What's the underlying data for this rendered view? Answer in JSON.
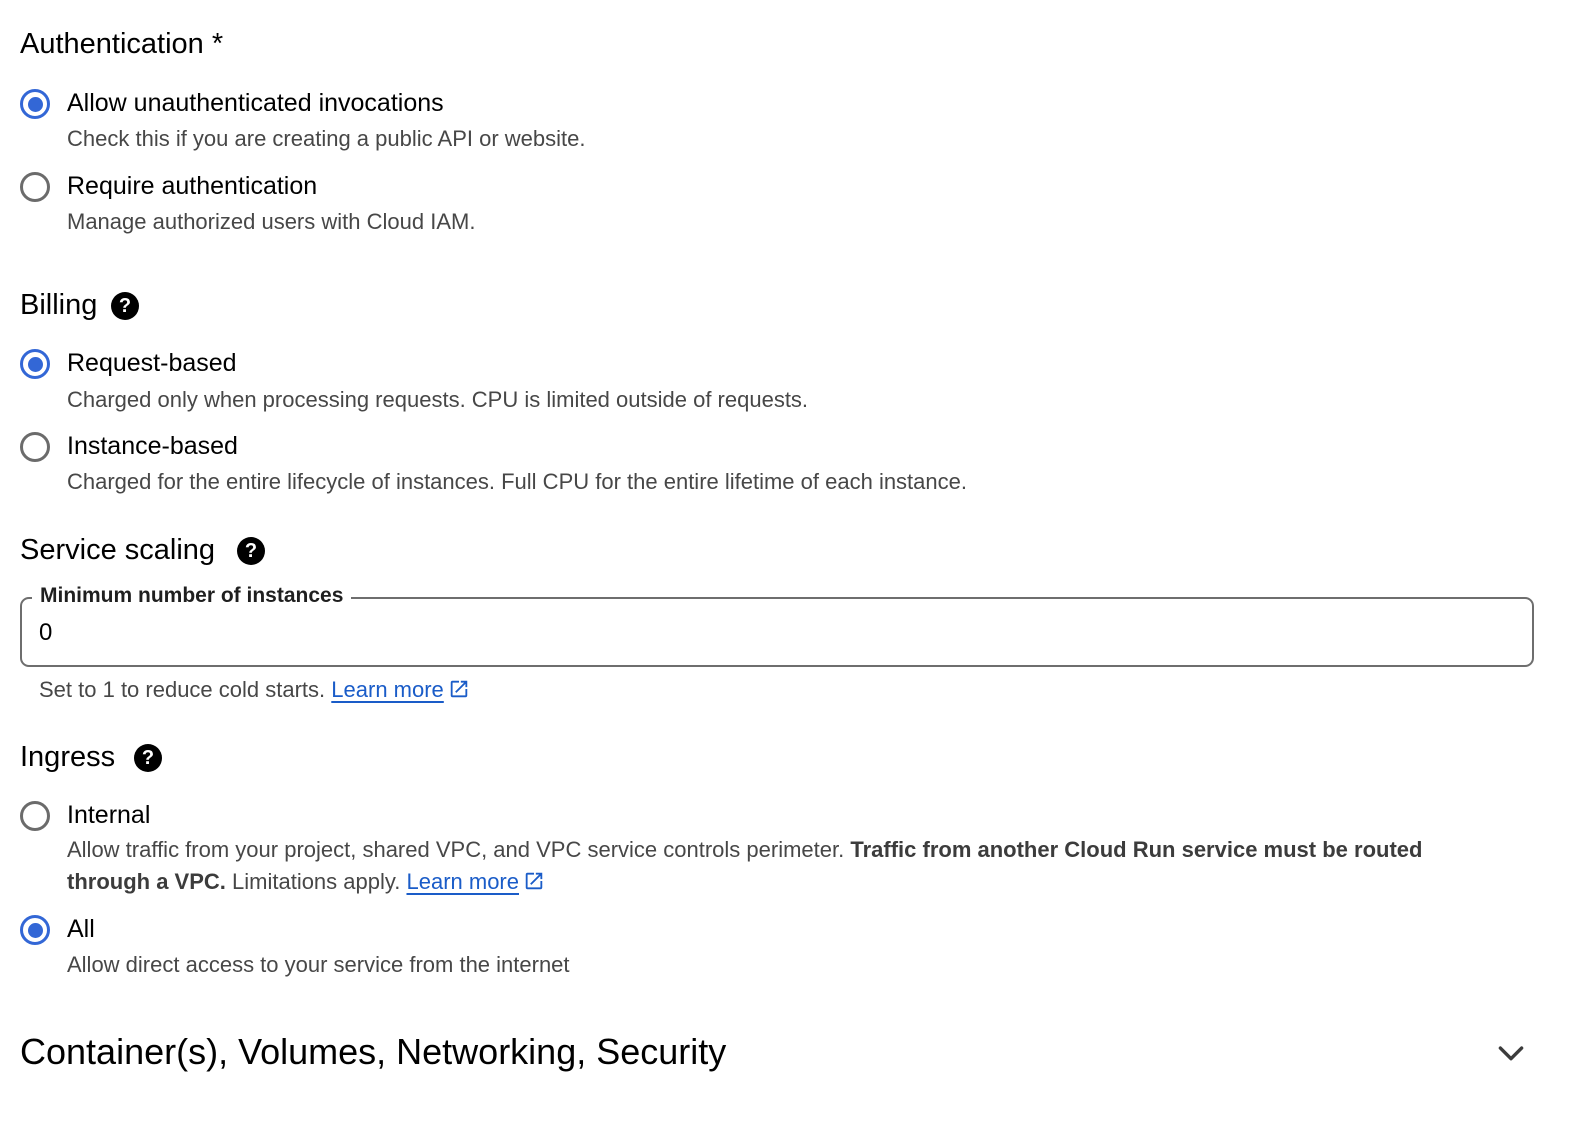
{
  "authentication": {
    "title": "Authentication *",
    "options": [
      {
        "label": "Allow unauthenticated invocations",
        "description": "Check this if you are creating a public API or website.",
        "selected": true
      },
      {
        "label": "Require authentication",
        "description": "Manage authorized users with Cloud IAM.",
        "selected": false
      }
    ]
  },
  "billing": {
    "title": "Billing",
    "help_icon": "help-circle-icon",
    "options": [
      {
        "label": "Request-based",
        "description": "Charged only when processing requests. CPU is limited outside of requests.",
        "selected": true
      },
      {
        "label": "Instance-based",
        "description": "Charged for the entire lifecycle of instances. Full CPU for the entire lifetime of each instance.",
        "selected": false
      }
    ]
  },
  "service_scaling": {
    "title": "Service scaling",
    "help_icon": "help-circle-icon",
    "min_instances": {
      "label": "Minimum number of instances",
      "value": "0",
      "hint": "Set to 1 to reduce cold starts.",
      "link": "Learn more"
    }
  },
  "ingress": {
    "title": "Ingress",
    "help_icon": "help-circle-icon",
    "options": [
      {
        "label": "Internal",
        "description_start": "Allow traffic from your project, shared VPC, and VPC service controls perimeter.",
        "description_bold": "Traffic from another Cloud Run service must be routed through a VPC.",
        "description_end": "Limitations apply.",
        "link": "Learn more",
        "selected": false
      },
      {
        "label": "All",
        "description": "Allow direct access to your service from the internet",
        "selected": true
      }
    ]
  },
  "advanced_section": {
    "title": "Container(s), Volumes, Networking, Security",
    "icon": "chevron-down-icon"
  },
  "colors": {
    "accent": "#3367d6",
    "link": "#1a5cc8",
    "text_primary": "#000000",
    "text_secondary": "#474747",
    "radio_unselected": "#6b6b6b"
  }
}
